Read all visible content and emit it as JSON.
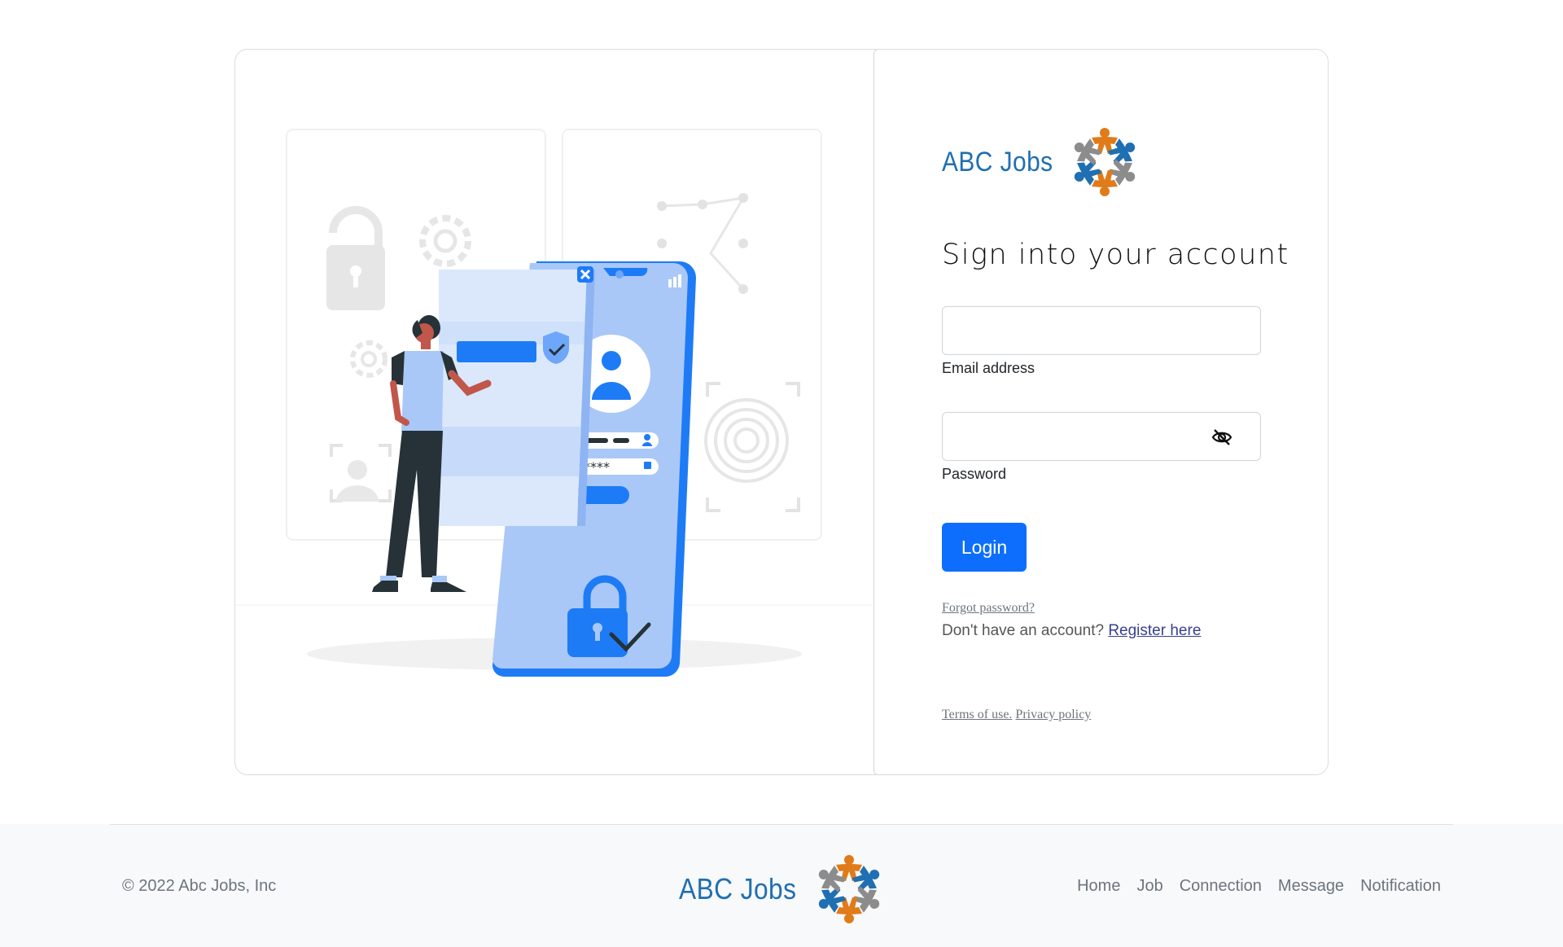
{
  "brand": {
    "name": "ABC Jobs",
    "primary": "#1f6fb2",
    "accent_orange": "#e07b1a",
    "accent_gray": "#8c8c8c"
  },
  "form": {
    "title": "Sign into your account",
    "email_label": "Email address",
    "email_value": "",
    "password_label": "Password",
    "password_value": "",
    "password_toggle_icon": "eye-slash-icon",
    "login_label": "Login",
    "forgot_label": "Forgot password?",
    "register_prompt": "Don't have an account? ",
    "register_label": "Register here",
    "terms_label": "Terms of use.",
    "privacy_label": "Privacy policy"
  },
  "footer": {
    "copyright": "© 2022 Abc Jobs, Inc",
    "nav": [
      "Home",
      "Job",
      "Connection",
      "Message",
      "Notification"
    ]
  },
  "colors": {
    "button": "#0d6efd",
    "illustration_blue": "#1e7bf6",
    "illustration_light": "#a9c8f7"
  }
}
